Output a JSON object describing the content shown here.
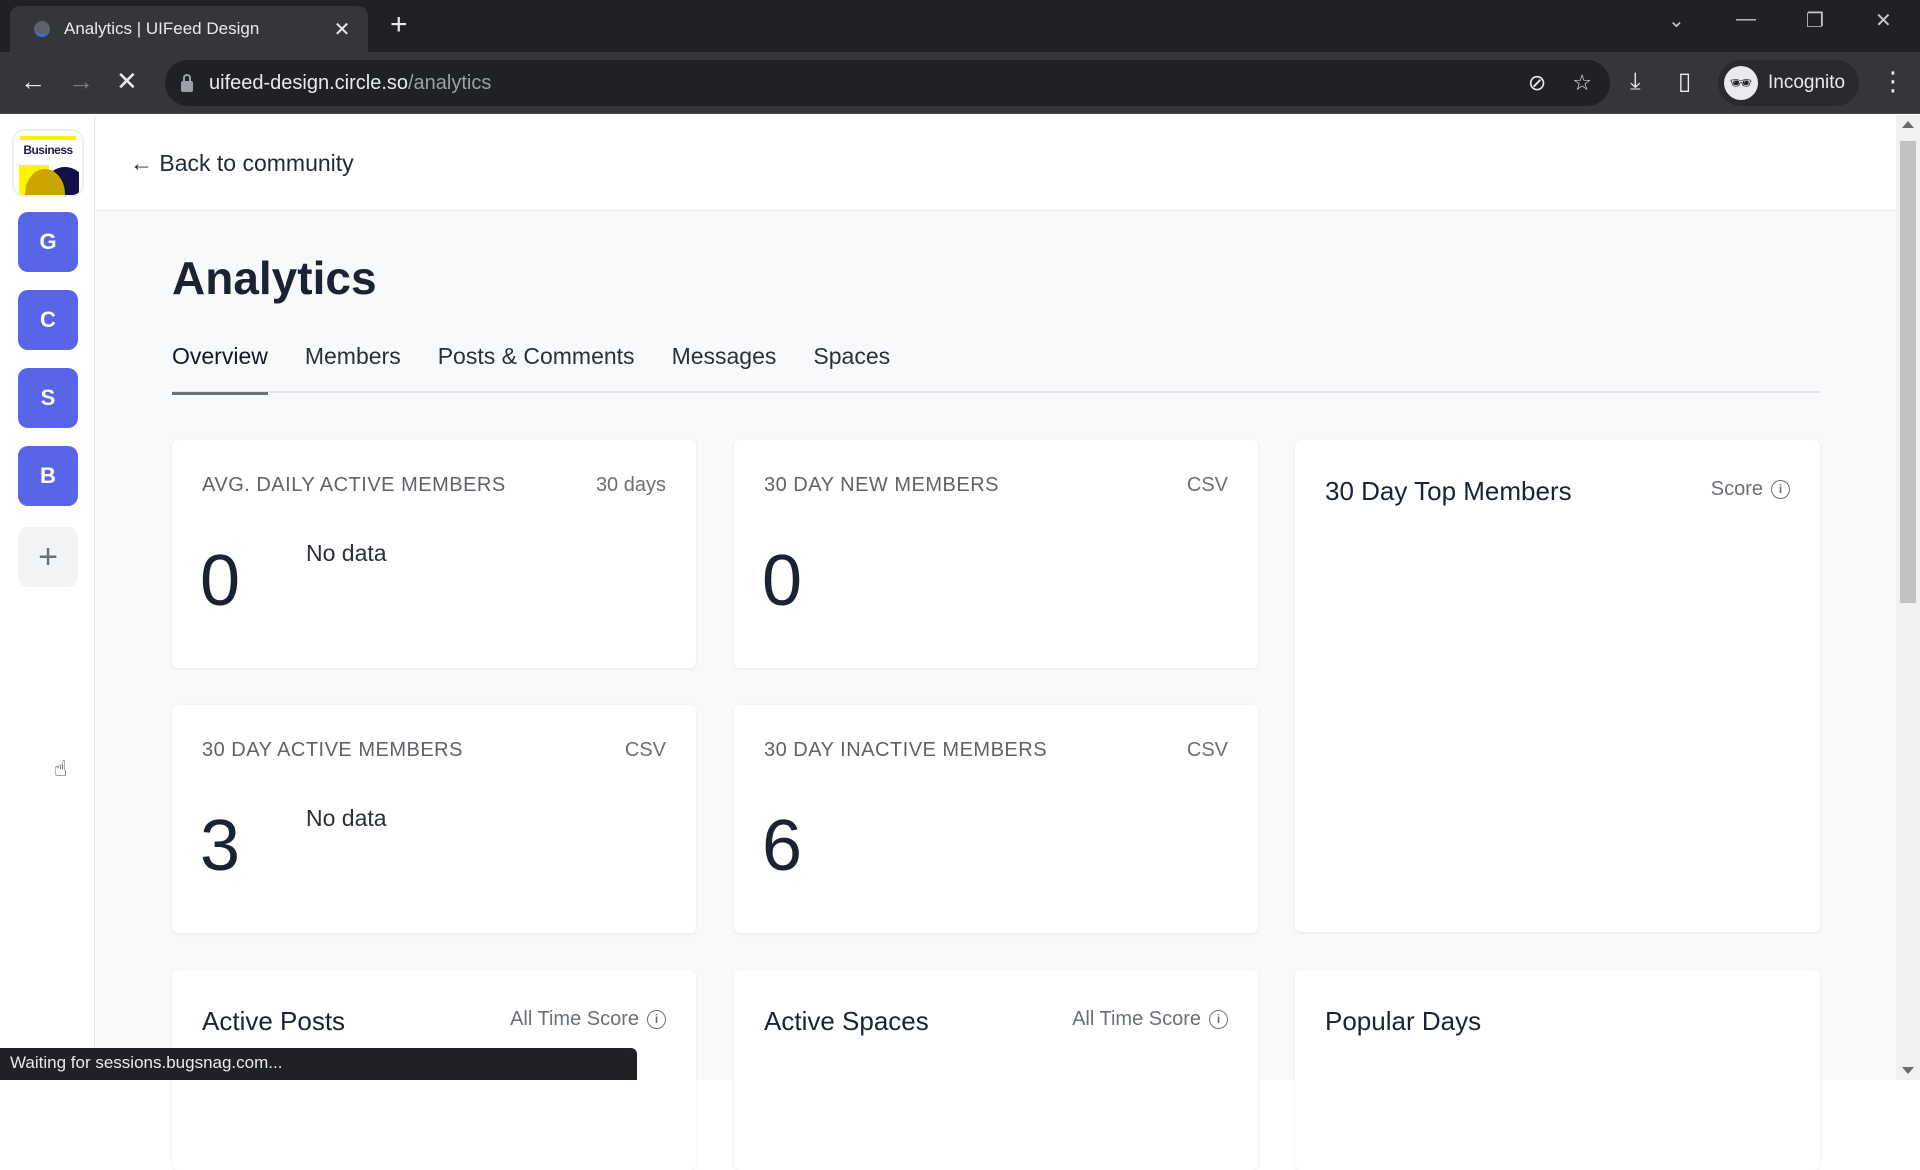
{
  "browser": {
    "tab_title": "Analytics | UIFeed Design",
    "url_host": "uifeed-design.circle.so",
    "url_path": "/analytics",
    "profile_label": "Incognito",
    "status_text": "Waiting for sessions.bugsnag.com..."
  },
  "icons": {
    "back": "←",
    "forward": "→",
    "stop": "✕",
    "close_tab": "✕",
    "new_tab": "+",
    "tab_search": "⌄",
    "minimize": "—",
    "restore": "❐",
    "close_window": "✕",
    "eye_off": "⊘",
    "star": "☆",
    "download": "⤓",
    "sidepanel": "▯",
    "incognito": "🕶",
    "menu": "⋮",
    "plus": "+",
    "info": "i",
    "hand_cursor": "☝"
  },
  "sidebar": {
    "logo_text": "Business",
    "spaces": [
      {
        "letter": "G"
      },
      {
        "letter": "C"
      },
      {
        "letter": "S"
      },
      {
        "letter": "B"
      }
    ],
    "accent_color": "#5865e6"
  },
  "header": {
    "back_link": "← Back to community"
  },
  "main": {
    "title": "Analytics",
    "tabs": [
      {
        "label": "Overview",
        "active": true
      },
      {
        "label": "Members"
      },
      {
        "label": "Posts & Comments"
      },
      {
        "label": "Messages"
      },
      {
        "label": "Spaces"
      }
    ],
    "stats": [
      {
        "label": "Avg. Daily Active Members",
        "action": "30 days",
        "value": "0",
        "note": "No data"
      },
      {
        "label": "30 Day New Members",
        "action": "CSV",
        "value": "0",
        "note": ""
      },
      {
        "label": "30 Day Active Members",
        "action": "CSV",
        "value": "3",
        "note": "No data"
      },
      {
        "label": "30 Day Inactive Members",
        "action": "CSV",
        "value": "6",
        "note": ""
      }
    ],
    "top_members": {
      "title": "30 Day Top Members",
      "meta": "Score"
    },
    "active_posts": {
      "title": "Active Posts",
      "meta": "All Time Score"
    },
    "active_spaces": {
      "title": "Active Spaces",
      "meta": "All Time Score"
    },
    "popular_days": {
      "title": "Popular Days"
    }
  }
}
